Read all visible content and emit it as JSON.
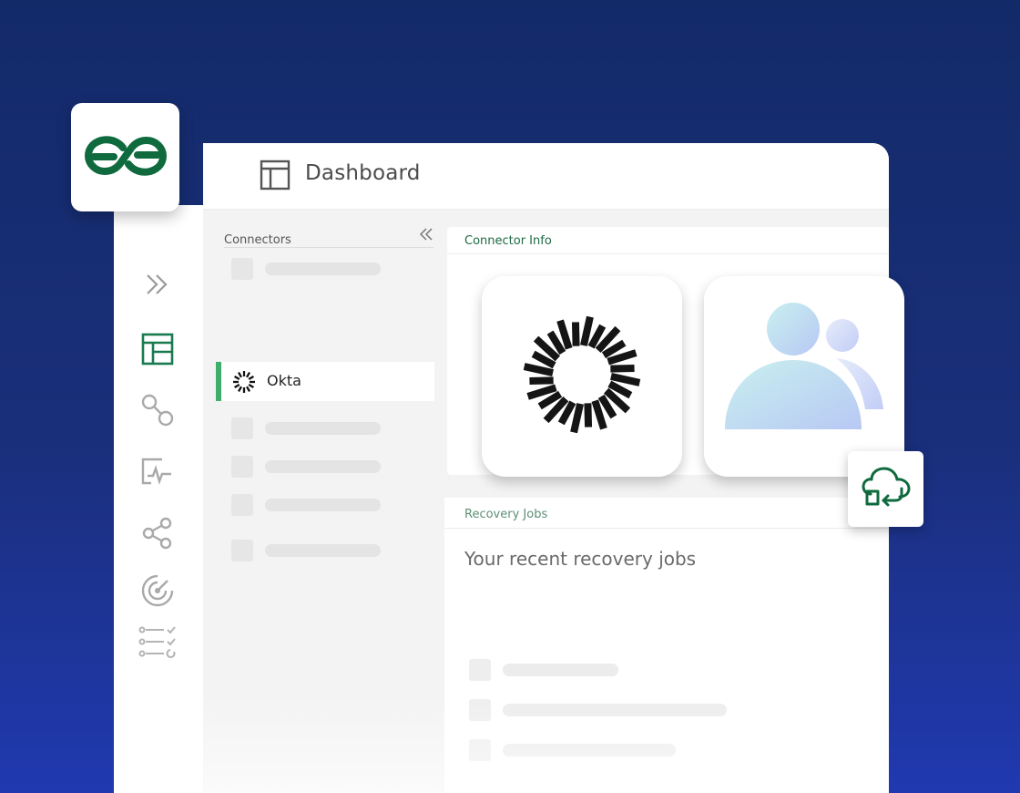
{
  "header": {
    "title": "Dashboard"
  },
  "rail": {
    "icons": [
      "expand-icon",
      "dashboard-icon",
      "connections-icon",
      "monitoring-icon",
      "share-icon",
      "target-icon",
      "checklist-icon"
    ],
    "accent_color": "#1a7a4f",
    "muted_color": "#a9a9a9"
  },
  "connectors": {
    "label": "Connectors",
    "selected": {
      "label": "Okta"
    }
  },
  "connector_info": {
    "label": "Connector Info"
  },
  "recovery_jobs": {
    "label": "Recovery Jobs",
    "subtitle": "Your recent recovery jobs"
  },
  "brand": {
    "logo": "infinity-logo",
    "color": "#0f6b3e"
  }
}
